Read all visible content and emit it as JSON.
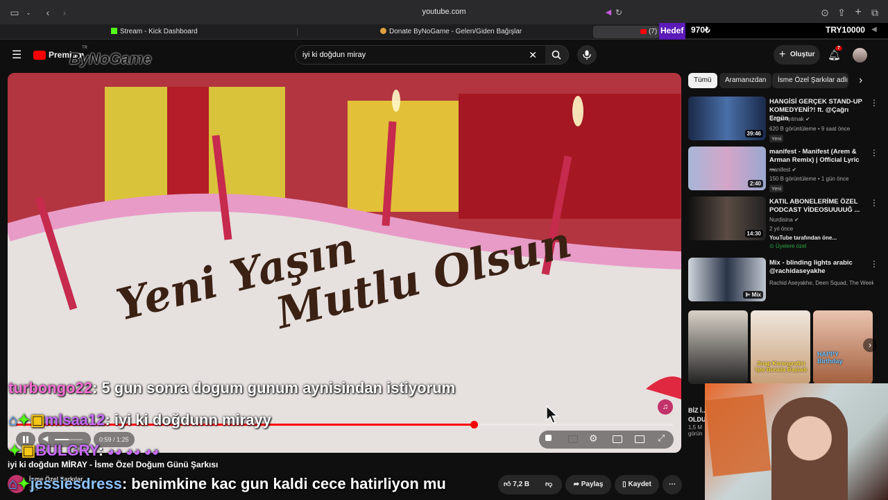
{
  "browser": {
    "url": "youtube.com",
    "tabs": [
      {
        "label": "Stream - Kick Dashboard"
      },
      {
        "label": "Donate ByNoGame - Gelen/Giden Bağışlar"
      },
      {
        "label": "(7)"
      }
    ]
  },
  "hud": {
    "goal_label": "Hedef",
    "amount": "970₺",
    "target": "TRY10000"
  },
  "youtube": {
    "logo_text": "Premium",
    "logo_region": "TR",
    "overlay_logo": "ByNoGame",
    "search_value": "iyi ki doğdun miray",
    "create_label": "Oluştur",
    "notif_count": "7"
  },
  "player": {
    "time": "0:59 / 1:25",
    "progress": 0.697,
    "volume": 0.5,
    "overlay_text_1": "Yeni Yaşın",
    "overlay_text_2": "Mutlu Olsun"
  },
  "video_title": "iyi ki doğdun MİRAY - İsme Özel Doğum Günü Şarkısı",
  "channel_snippet": "İsme Özel Şarkılar",
  "channel_subs": "391",
  "actions": {
    "likes": "7,2 B",
    "share": "Paylaş",
    "save": "Kaydet"
  },
  "chat": [
    {
      "user": "turbongo22",
      "msg": ": 5 gun sonra dogum gunum aynisindan istiyorum"
    },
    {
      "user": "mlsaa12",
      "msg": ": iyi ki doğdunn mirayy"
    },
    {
      "user": "BULGRY",
      "msg": ":"
    },
    {
      "user": "jessiesdress",
      "msg": ": benimkine kac gun kaldi cece hatirliyon mu"
    }
  ],
  "chips": [
    "Tümü",
    "Aramanızdan",
    "İsme Özel Şarkılar adlı y"
  ],
  "recommendations": [
    {
      "title": "HANGİSİ GERÇEK STAND-UP KOMEDYENİ?! ft. @Çağrı Ergün",
      "channel": "Orkun Işıtmak",
      "meta": "620 B görüntüleme • 9 saat önce",
      "badge": "Yeni",
      "duration": "39:46"
    },
    {
      "title": "manifest - Manifest (Arem & Arman Remix) | Official Lyric ...",
      "channel": "manifest",
      "meta": "150 B görüntüleme • 1 gün önce",
      "badge": "Yeni",
      "duration": "2:40"
    },
    {
      "title": "KATIL ABONELERİME ÖZEL PODCAST VİDEOSUUUUĞ ...",
      "channel": "Nurdisina",
      "meta": "2 yıl önce",
      "extra": "YouTube tarafından öne...",
      "badge": "Üyelere özel",
      "duration": "14:30"
    },
    {
      "title": "Mix - blinding lights arabic @rachidaseyakhe",
      "channel": "Rachid Aseyakhe, Deen Squad, The Week...",
      "meta": "",
      "badge": "",
      "duration": "Mix"
    }
  ],
  "shorts": [
    {
      "caption": ""
    },
    {
      "caption": "Snap Koreografisi İşte Burada Başladı"
    },
    {
      "caption": "HAPPY Birthday"
    }
  ],
  "side_partial": {
    "title": "BİZ İ... OLDU",
    "meta": "1,5 M görün"
  }
}
